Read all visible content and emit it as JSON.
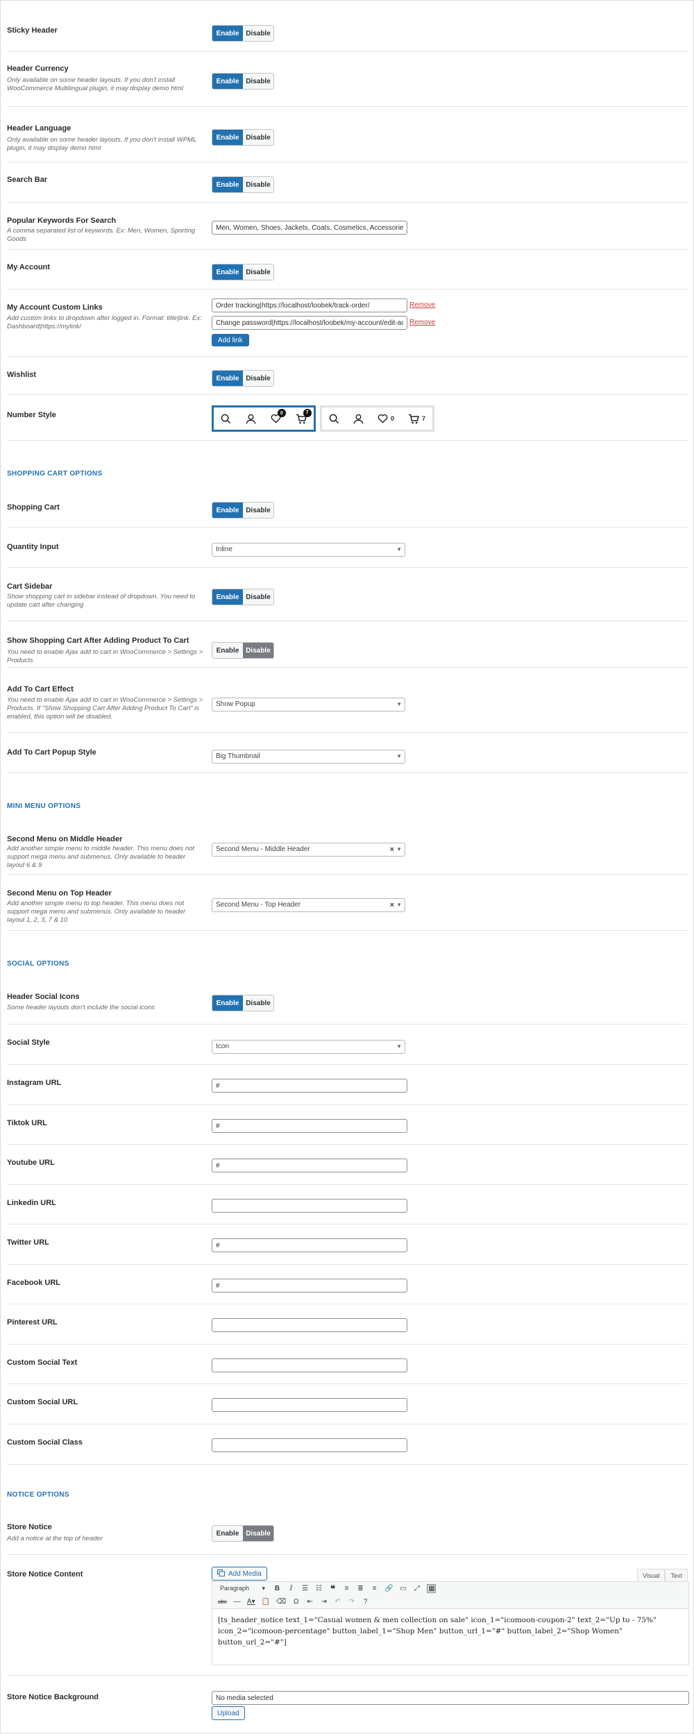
{
  "sticky_header": {
    "label": "Sticky Header",
    "enable": "Enable",
    "disable": "Disable"
  },
  "header_currency": {
    "label": "Header Currency",
    "desc": "Only available on some header layouts. If you don't install WooCommerce Multilingual plugin, it may display demo html",
    "enable": "Enable",
    "disable": "Disable"
  },
  "header_language": {
    "label": "Header Language",
    "desc": "Only available on some header layouts. If you don't install WPML plugin, it may display demo html",
    "enable": "Enable",
    "disable": "Disable"
  },
  "search_bar": {
    "label": "Search Bar",
    "enable": "Enable",
    "disable": "Disable"
  },
  "popular_keywords": {
    "label": "Popular Keywords For Search",
    "desc": "A comma separated list of keywords. Ex: Men, Women, Sporting Goods",
    "value": "Men, Women, Shoes, Jackets, Coats, Cosmetics, Accessories"
  },
  "my_account": {
    "label": "My Account",
    "enable": "Enable",
    "disable": "Disable"
  },
  "custom_links": {
    "label": "My Account Custom Links",
    "desc": "Add custom links to dropdown after logged in. Format: title|link. Ex: Dashboard|https://mylink/",
    "links": [
      "Order tracking|https://localhost/loobek/track-order/",
      "Change password|https://localhost/loobek/my-account/edit-account/"
    ],
    "remove": "Remove",
    "add": "Add link"
  },
  "wishlist": {
    "label": "Wishlist",
    "enable": "Enable",
    "disable": "Disable"
  },
  "number_style": {
    "label": "Number Style",
    "style1": {
      "wishlist": "0",
      "cart": "7"
    },
    "style2": {
      "wishlist": "0",
      "cart": "7"
    }
  },
  "sections": {
    "shopping_cart": "SHOPPING CART OPTIONS",
    "mini_menu": "MINI MENU OPTIONS",
    "social": "SOCIAL OPTIONS",
    "notice": "NOTICE OPTIONS"
  },
  "shopping_cart": {
    "label": "Shopping Cart",
    "enable": "Enable",
    "disable": "Disable"
  },
  "quantity_input": {
    "label": "Quantity Input",
    "value": "Inline"
  },
  "cart_sidebar": {
    "label": "Cart Sidebar",
    "desc": "Show shopping cart in sidebar instead of dropdown. You need to update cart after changing",
    "enable": "Enable",
    "disable": "Disable"
  },
  "show_cart_after_add": {
    "label": "Show Shopping Cart After Adding Product To Cart",
    "desc": "You need to enable Ajax add to cart in WooCommerce > Settings > Products",
    "enable": "Enable",
    "disable": "Disable"
  },
  "add_to_cart_effect": {
    "label": "Add To Cart Effect",
    "desc": "You need to enable Ajax add to cart in WooCommerce > Settings > Products. If \"Show Shopping Cart After Adding Product To Cart\" is enabled, this option will be disabled.",
    "value": "Show Popup"
  },
  "popup_style": {
    "label": "Add To Cart Popup Style",
    "value": "Big Thumbnail"
  },
  "second_menu_middle": {
    "label": "Second Menu on Middle Header",
    "desc": "Add another simple menu to middle header. This menu does not support mega menu and submenus. Only available to header layout 6 & 9",
    "value": "Second Menu - Middle Header"
  },
  "second_menu_top": {
    "label": "Second Menu on Top Header",
    "desc": "Add another simple menu to top header. This menu does not support mega menu and submenus. Only available to header layout 1, 2, 3, 7 & 10",
    "value": "Second Menu - Top Header"
  },
  "header_social_icons": {
    "label": "Header Social Icons",
    "desc": "Some header layouts don't include the social icons",
    "enable": "Enable",
    "disable": "Disable"
  },
  "social_style": {
    "label": "Social Style",
    "value": "Icon"
  },
  "social_urls": [
    {
      "label": "Instagram URL",
      "value": "#"
    },
    {
      "label": "Tiktok URL",
      "value": "#"
    },
    {
      "label": "Youtube URL",
      "value": "#"
    },
    {
      "label": "Linkedin URL",
      "value": ""
    },
    {
      "label": "Twitter URL",
      "value": "#"
    },
    {
      "label": "Facebook URL",
      "value": "#"
    },
    {
      "label": "Pinterest URL",
      "value": ""
    },
    {
      "label": "Custom Social Text",
      "value": ""
    },
    {
      "label": "Custom Social URL",
      "value": ""
    },
    {
      "label": "Custom Social Class",
      "value": ""
    }
  ],
  "store_notice": {
    "label": "Store Notice",
    "desc": "Add a notice at the top of header",
    "enable": "Enable",
    "disable": "Disable"
  },
  "notice_content": {
    "label": "Store Notice Content",
    "add_media": "Add Media",
    "visual_tab": "Visual",
    "text_tab": "Text",
    "format": "Paragraph",
    "content": "[ts_header_notice text_1=\"Casual women & men collection on sale\" icon_1=\"icomoon-coupon-2\" text_2=\"Up to - 75%\" icon_2=\"icomoon-percentage\" button_label_1=\"Shop Men\" button_url_1=\"#\" button_label_2=\"Shop Women\" button_url_2=\"#\"]"
  },
  "notice_bg": {
    "label": "Store Notice Background",
    "value": "No media selected",
    "upload": "Upload"
  },
  "colors": {
    "accent": "#2271b1",
    "remove": "#d63638",
    "disabled_active": "#787c82"
  }
}
